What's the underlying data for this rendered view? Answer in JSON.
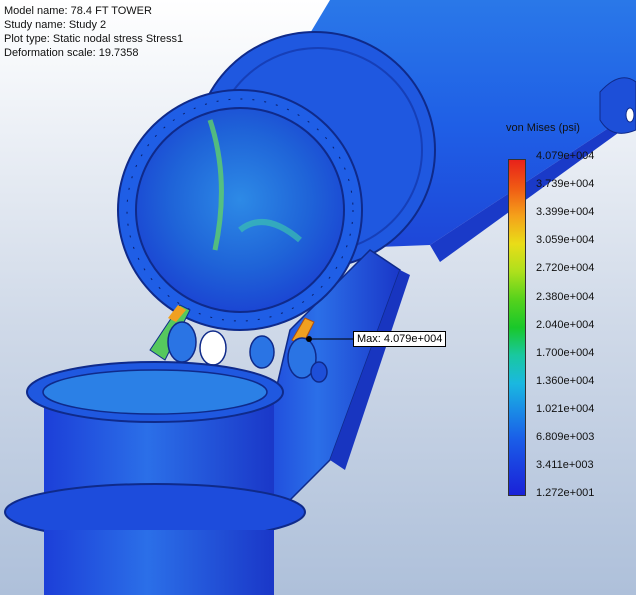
{
  "info": {
    "model_name": "Model name: 78.4 FT TOWER",
    "study_name": "Study name: Study 2",
    "plot_type": "Plot type: Static nodal stress Stress1",
    "deformation_scale": "Deformation scale: 19.7358"
  },
  "legend": {
    "title": "von Mises (psi)",
    "labels": [
      "4.079e+004",
      "3.739e+004",
      "3.399e+004",
      "3.059e+004",
      "2.720e+004",
      "2.380e+004",
      "2.040e+004",
      "1.700e+004",
      "1.360e+004",
      "1.021e+004",
      "6.809e+003",
      "3.411e+003",
      "1.272e+001"
    ],
    "colors": [
      "#e8221a",
      "#f05a14",
      "#f5a11a",
      "#e9dd18",
      "#aee01c",
      "#55d21c",
      "#19c82a",
      "#19c8a0",
      "#1ab8e0",
      "#1a8ae6",
      "#1a5ee8",
      "#1a3ee0",
      "#1a22d8"
    ]
  },
  "callout": {
    "label": "Max: 4.079e+004"
  }
}
